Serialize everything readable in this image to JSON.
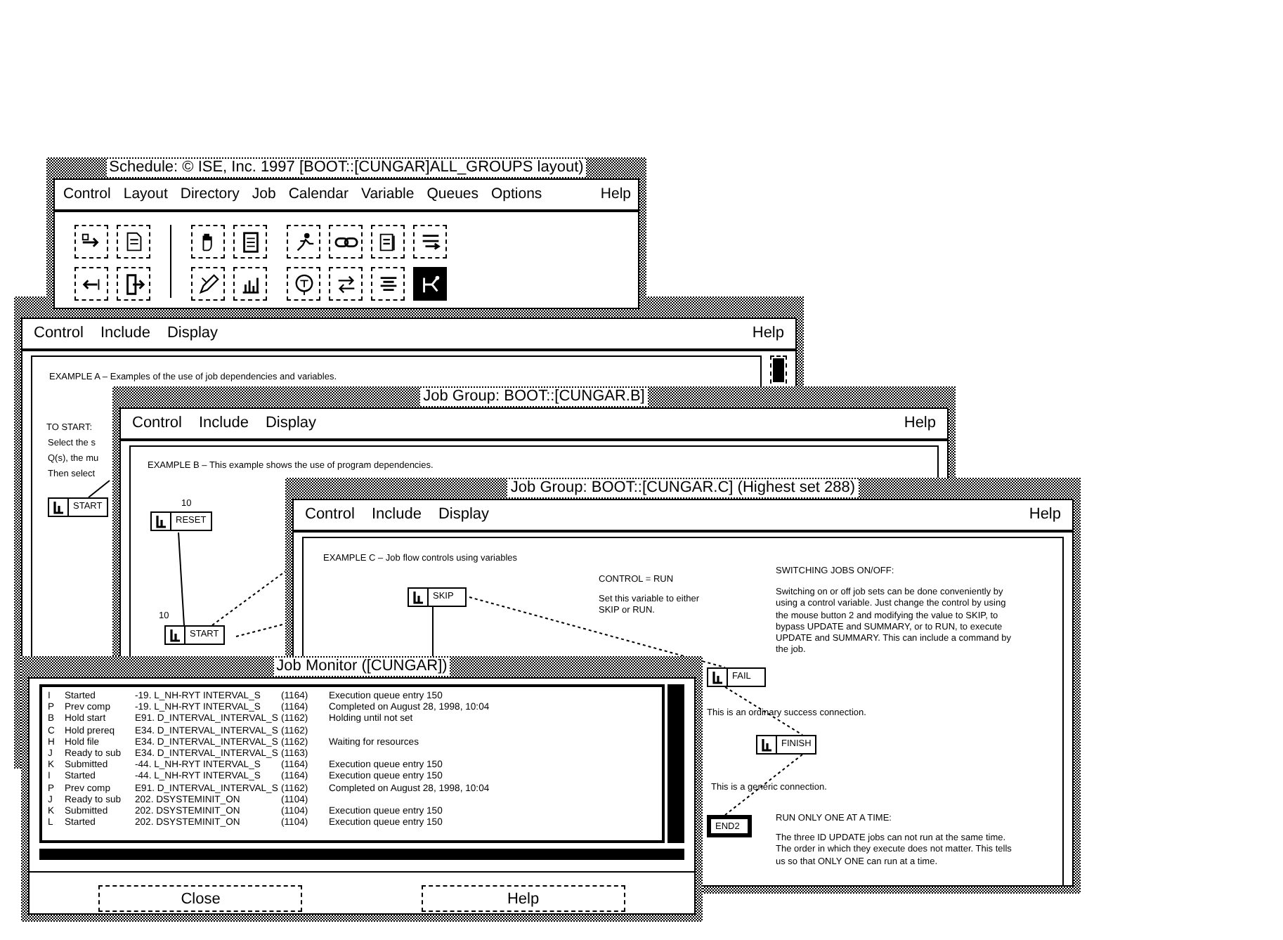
{
  "schedule_window": {
    "title": "Schedule: © ISE, Inc. 1997 [BOOT::[CUNGAR]ALL_GROUPS layout)",
    "menu": [
      "Control",
      "Layout",
      "Directory",
      "Job",
      "Calendar",
      "Variable",
      "Queues",
      "Options"
    ],
    "help_menu": "Help",
    "toolbar": [
      {
        "selected": false
      },
      {
        "selected": false
      },
      {
        "selected": false
      },
      {
        "selected": false
      },
      {
        "selected": false
      },
      {
        "selected": false
      },
      {
        "selected": false
      },
      {
        "selected": false
      },
      {
        "selected": false
      },
      {
        "selected": false
      },
      {
        "selected": false
      },
      {
        "selected": false
      },
      {
        "selected": false
      },
      {
        "selected": false
      },
      {
        "selected": false
      },
      {
        "selected": true
      }
    ]
  },
  "group_windows": [
    {
      "menu": [
        "Control",
        "Include",
        "Display"
      ],
      "help_menu": "Help",
      "notes": [
        "EXAMPLE A – Examples of the use of job dependencies and variables.",
        "TO START:",
        "Select the s",
        "Q(s), the mu",
        "Then select"
      ],
      "nodes": [
        {
          "kind": "job",
          "label": "START"
        }
      ]
    },
    {
      "title": "Job Group: BOOT::[CUNGAR.B]",
      "menu": [
        "Control",
        "Include",
        "Display"
      ],
      "help_menu": "Help",
      "notes": [
        "EXAMPLE B – This example shows the use of program dependencies.",
        "10",
        "10"
      ],
      "nodes": [
        {
          "kind": "job",
          "label": "RESET"
        },
        {
          "kind": "job",
          "label": "START"
        }
      ]
    },
    {
      "title": "Job Group: BOOT::[CUNGAR.C] (Highest set 288)",
      "menu": [
        "Control",
        "Include",
        "Display"
      ],
      "help_menu": "Help",
      "notes": [
        "EXAMPLE C – Job flow controls using variables",
        "CONTROL = RUN",
        "Set this variable to either SKIP or RUN.",
        "SWITCHING JOBS ON/OFF:",
        "Switching on or off job sets can be done conveniently by using a control variable. Just change the control by using the mouse button 2 and modifying the value to SKIP, to bypass UPDATE and SUMMARY, or to RUN, to execute UPDATE and SUMMARY. This can include a command by the job.",
        "This is an ordinary success connection.",
        "This is a generic connection.",
        "RUN ONLY ONE AT A TIME:",
        "The three ID UPDATE jobs can not run at the same time. The order in which they execute does not matter. This tells us so that ONLY ONE can run at a time."
      ],
      "nodes": [
        {
          "kind": "job",
          "label": "SKIP"
        },
        {
          "kind": "job",
          "label": "FAIL"
        },
        {
          "kind": "job",
          "label": "FINISH"
        },
        {
          "kind": "terminal",
          "label": "END2"
        }
      ]
    }
  ],
  "job_monitor": {
    "title": "Job Monitor ([CUNGAR])",
    "rows": [
      [
        "I",
        "Started",
        "-19. L_NH-RYT INTERVAL_S",
        "(1164)",
        "Execution queue entry 150"
      ],
      [
        "P",
        "Prev comp",
        "-19. L_NH-RYT INTERVAL_S",
        "(1164)",
        "Completed on August 28, 1998, 10:04"
      ],
      [
        "B",
        "Hold start",
        "E91. D_INTERVAL_INTERVAL_S",
        "(1162)",
        "Holding until not set"
      ],
      [
        "C",
        "Hold prereq",
        "E34. D_INTERVAL_INTERVAL_S",
        "(1162)",
        ""
      ],
      [
        "H",
        "Hold file",
        "E34. D_INTERVAL_INTERVAL_S",
        "(1162)",
        "Waiting for resources"
      ],
      [
        "J",
        "Ready to sub",
        "E34. D_INTERVAL_INTERVAL_S",
        "(1163)",
        ""
      ],
      [
        "K",
        "Submitted",
        "-44. L_NH-RYT INTERVAL_S",
        "(1164)",
        "Execution queue entry 150"
      ],
      [
        "I",
        "Started",
        "-44. L_NH-RYT INTERVAL_S",
        "(1164)",
        "Execution queue entry 150"
      ],
      [
        "P",
        "Prev comp",
        "E91. D_INTERVAL_INTERVAL_S",
        "(1162)",
        "Completed on August 28, 1998, 10:04"
      ],
      [
        "J",
        "Ready to sub",
        "202. DSYSTEMINIT_ON",
        "(1104)",
        ""
      ],
      [
        "K",
        "Submitted",
        "202. DSYSTEMINIT_ON",
        "(1104)",
        "Execution queue entry 150"
      ],
      [
        "L",
        "Started",
        "202. DSYSTEMINIT_ON",
        "(1104)",
        "Execution queue entry 150"
      ]
    ],
    "buttons": [
      "Close",
      "Help"
    ]
  }
}
